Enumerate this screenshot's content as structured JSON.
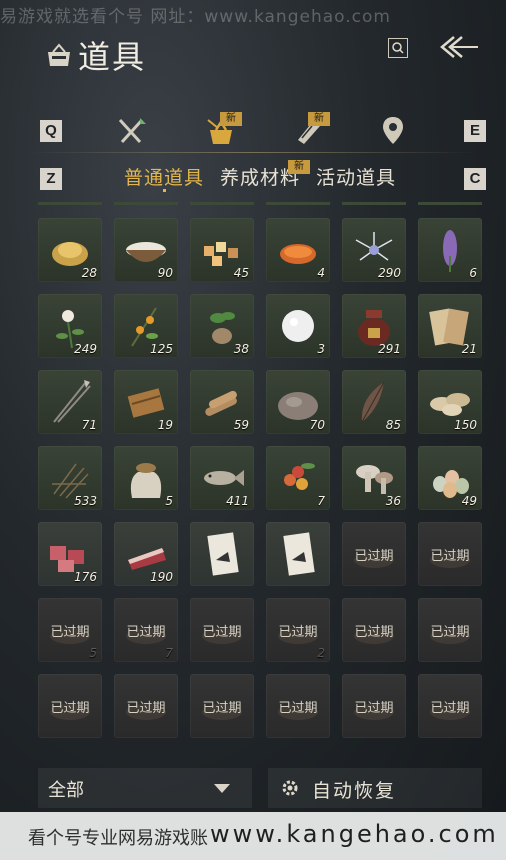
{
  "watermark_top": "易游戏就选看个号  网址：www.kangehao.com",
  "watermark_bottom": {
    "left": "看个号专业网易游戏账",
    "url": "www.kangehao.com"
  },
  "header": {
    "title": "道具"
  },
  "category_keys": {
    "left": "Q",
    "right": "E"
  },
  "category_badges": {
    "tab2": "新",
    "tab3": "新"
  },
  "sub_keys": {
    "left": "Z",
    "right": "C"
  },
  "subtabs": [
    {
      "label": "普通道具",
      "active": true
    },
    {
      "label": "养成材料",
      "badge": "新"
    },
    {
      "label": "活动道具"
    }
  ],
  "expired_label": "已过期",
  "items": [
    {
      "icon": "gold-ingot-icon",
      "qty": "28"
    },
    {
      "icon": "rice-bowl-icon",
      "qty": "90"
    },
    {
      "icon": "sweet-cakes-icon",
      "qty": "45"
    },
    {
      "icon": "salted-egg-yolk-icon",
      "qty": "4"
    },
    {
      "icon": "silver-flower-icon",
      "qty": "290"
    },
    {
      "icon": "purple-flower-icon",
      "qty": "6"
    },
    {
      "icon": "white-blossom-herb-icon",
      "qty": "249"
    },
    {
      "icon": "orange-fruit-branch-icon",
      "qty": "125"
    },
    {
      "icon": "root-herb-icon",
      "qty": "38"
    },
    {
      "icon": "white-ball-icon",
      "qty": "3"
    },
    {
      "icon": "wine-jar-icon",
      "qty": "291"
    },
    {
      "icon": "paper-scrolls-icon",
      "qty": "21"
    },
    {
      "icon": "arrows-icon",
      "qty": "71"
    },
    {
      "icon": "hemp-bundle-icon",
      "qty": "19"
    },
    {
      "icon": "wood-logs-icon",
      "qty": "59"
    },
    {
      "icon": "stone-icon",
      "qty": "70"
    },
    {
      "icon": "feather-icon",
      "qty": "85"
    },
    {
      "icon": "mushroom-slices-icon",
      "qty": "150"
    },
    {
      "icon": "dry-grass-icon",
      "qty": "533"
    },
    {
      "icon": "grain-sack-icon",
      "qty": "5"
    },
    {
      "icon": "fish-icon",
      "qty": "411"
    },
    {
      "icon": "red-berries-icon",
      "qty": "7"
    },
    {
      "icon": "mushrooms-icon",
      "qty": "36"
    },
    {
      "icon": "eggs-icon",
      "qty": "49"
    },
    {
      "icon": "meat-chunks-icon",
      "qty": "176"
    },
    {
      "icon": "meat-slab-icon",
      "qty": "190"
    },
    {
      "icon": "horse-card-icon",
      "qty": ""
    },
    {
      "icon": "horse-card-icon",
      "qty": ""
    },
    {
      "icon": "expired-item-icon",
      "expired": true,
      "qty": ""
    },
    {
      "icon": "expired-item-icon",
      "expired": true,
      "qty": ""
    },
    {
      "icon": "expired-item-icon",
      "expired": true,
      "qty": "5"
    },
    {
      "icon": "expired-item-icon",
      "expired": true,
      "qty": "7"
    },
    {
      "icon": "expired-item-icon",
      "expired": true,
      "qty": ""
    },
    {
      "icon": "expired-item-icon",
      "expired": true,
      "qty": "2"
    },
    {
      "icon": "expired-item-icon",
      "expired": true,
      "qty": ""
    },
    {
      "icon": "expired-item-icon",
      "expired": true,
      "qty": ""
    },
    {
      "icon": "expired-item-icon",
      "expired": true,
      "qty": ""
    },
    {
      "icon": "expired-item-icon",
      "expired": true,
      "qty": ""
    },
    {
      "icon": "expired-item-icon",
      "expired": true,
      "qty": ""
    },
    {
      "icon": "expired-item-icon",
      "expired": true,
      "qty": ""
    },
    {
      "icon": "expired-item-icon",
      "expired": true,
      "qty": ""
    },
    {
      "icon": "expired-item-icon",
      "expired": true,
      "qty": ""
    }
  ],
  "footer": {
    "filter_label": "全部",
    "auto_restore_label": "自动恢复"
  },
  "colors": {
    "accent_gold": "#e2b54d",
    "badge_gold": "#c69a3d"
  }
}
